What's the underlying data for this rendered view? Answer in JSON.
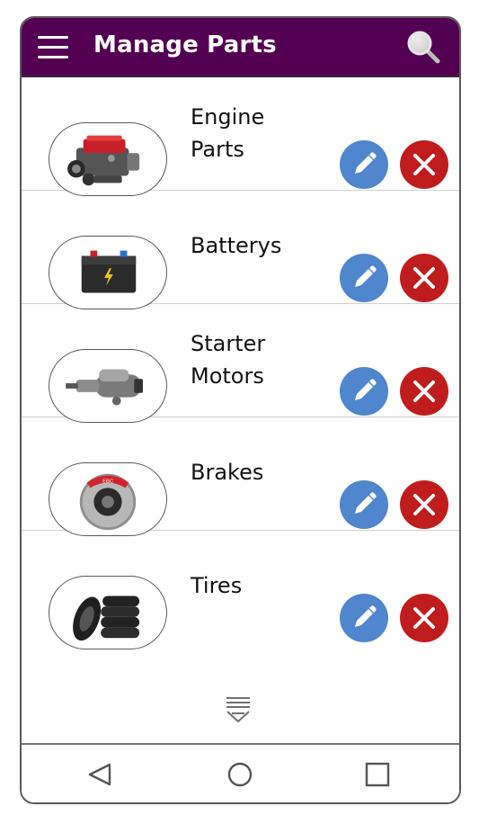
{
  "header": {
    "title": "Manage Parts",
    "background_color": "#540052",
    "menu_icon": "hamburger-menu-icon",
    "search_icon": "search-icon"
  },
  "parts": [
    {
      "name": "Engine Parts",
      "lines": [
        "Engine",
        "Parts"
      ],
      "image": "engine-image"
    },
    {
      "name": "Batterys",
      "lines": [
        "Batterys"
      ],
      "image": "battery-image"
    },
    {
      "name": "Starter Motors",
      "lines": [
        "Starter",
        "Motors"
      ],
      "image": "starter-motor-image"
    },
    {
      "name": "Brakes",
      "lines": [
        "Brakes"
      ],
      "image": "brake-disc-image"
    },
    {
      "name": "Tires",
      "lines": [
        "Tires"
      ],
      "image": "tires-image"
    }
  ],
  "actions": {
    "edit_icon": "pencil-icon",
    "edit_color": "#4f86cd",
    "delete_icon": "close-icon",
    "delete_color": "#bf1d1d"
  },
  "load_more_icon": "chevron-down-lines-icon",
  "nav": {
    "back_icon": "back-triangle-icon",
    "home_icon": "home-circle-icon",
    "recents_icon": "recents-square-icon"
  }
}
